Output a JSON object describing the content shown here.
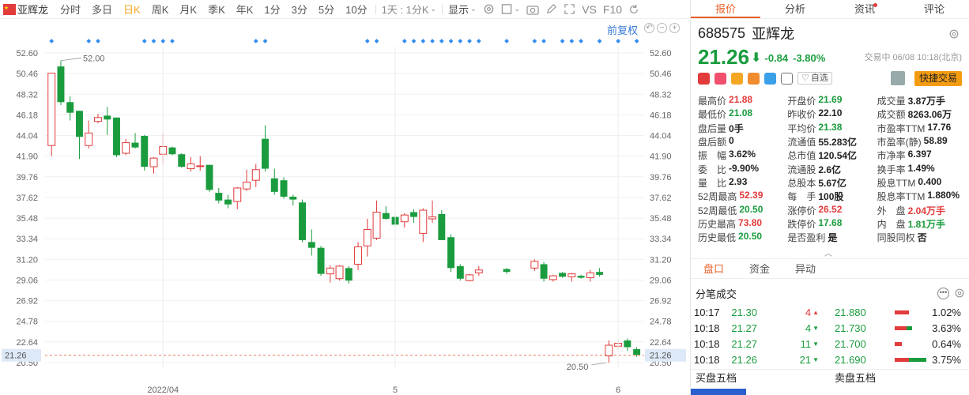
{
  "toolbar": {
    "stock_name": "亚辉龙",
    "periods": [
      "分时",
      "多日",
      "日K",
      "周K",
      "月K",
      "季K",
      "年K",
      "1分",
      "3分",
      "5分",
      "10分"
    ],
    "active_period": "日K",
    "interval_label": "1天 : 1分K",
    "display_label": "显示",
    "compare_label": "VS",
    "f10_label": "F10"
  },
  "chart": {
    "restore_label": "前复权",
    "max_label": "52.00",
    "min_label": "20.50",
    "current_label": "21.26"
  },
  "chart_data": {
    "type": "candlestick",
    "ylim": [
      20.5,
      52.6
    ],
    "y_ticks": [
      "52.60",
      "50.46",
      "48.32",
      "46.18",
      "44.04",
      "41.90",
      "39.76",
      "37.62",
      "35.48",
      "33.34",
      "31.20",
      "29.06",
      "26.92",
      "24.78",
      "22.64",
      "20.50"
    ],
    "x_labels": [
      "2022/04",
      "5",
      "6"
    ],
    "gap_between_candles": [
      46,
      47
    ],
    "current_price": 21.26,
    "candles": [
      {
        "o": 43.0,
        "h": 50.5,
        "l": 41.9,
        "c": 50.5
      },
      {
        "o": 51.2,
        "h": 51.8,
        "l": 47.2,
        "c": 47.5
      },
      {
        "o": 47.5,
        "h": 48.1,
        "l": 45.6,
        "c": 46.4
      },
      {
        "o": 46.6,
        "h": 46.6,
        "l": 41.6,
        "c": 43.9
      },
      {
        "o": 43.0,
        "h": 45.6,
        "l": 42.7,
        "c": 44.3
      },
      {
        "o": 45.5,
        "h": 46.3,
        "l": 45.3,
        "c": 45.9
      },
      {
        "o": 46.1,
        "h": 47.0,
        "l": 44.1,
        "c": 45.7
      },
      {
        "o": 45.9,
        "h": 45.9,
        "l": 41.8,
        "c": 42.0
      },
      {
        "o": 42.2,
        "h": 43.7,
        "l": 42.0,
        "c": 43.3
      },
      {
        "o": 43.3,
        "h": 44.3,
        "l": 42.7,
        "c": 42.8
      },
      {
        "o": 44.0,
        "h": 44.1,
        "l": 40.4,
        "c": 40.8
      },
      {
        "o": 40.8,
        "h": 41.8,
        "l": 40.1,
        "c": 41.7
      },
      {
        "o": 42.1,
        "h": 44.3,
        "l": 41.0,
        "c": 42.9
      },
      {
        "o": 42.8,
        "h": 42.9,
        "l": 42.0,
        "c": 42.1
      },
      {
        "o": 42.1,
        "h": 42.2,
        "l": 40.7,
        "c": 40.8
      },
      {
        "o": 40.6,
        "h": 41.8,
        "l": 40.3,
        "c": 41.1
      },
      {
        "o": 40.9,
        "h": 41.9,
        "l": 40.4,
        "c": 40.9
      },
      {
        "o": 41.0,
        "h": 41.0,
        "l": 38.2,
        "c": 38.4
      },
      {
        "o": 38.1,
        "h": 38.6,
        "l": 37.0,
        "c": 37.3
      },
      {
        "o": 37.4,
        "h": 37.9,
        "l": 36.5,
        "c": 36.9
      },
      {
        "o": 37.2,
        "h": 38.7,
        "l": 36.4,
        "c": 38.6
      },
      {
        "o": 38.5,
        "h": 40.5,
        "l": 38.3,
        "c": 39.2
      },
      {
        "o": 39.4,
        "h": 41.1,
        "l": 38.7,
        "c": 40.5
      },
      {
        "o": 43.7,
        "h": 45.1,
        "l": 40.3,
        "c": 40.6
      },
      {
        "o": 39.6,
        "h": 40.6,
        "l": 37.9,
        "c": 38.2
      },
      {
        "o": 39.4,
        "h": 39.7,
        "l": 37.5,
        "c": 37.7
      },
      {
        "o": 37.7,
        "h": 37.9,
        "l": 36.8,
        "c": 37.4
      },
      {
        "o": 37.1,
        "h": 37.4,
        "l": 33.0,
        "c": 33.2
      },
      {
        "o": 33.0,
        "h": 34.3,
        "l": 31.6,
        "c": 32.4
      },
      {
        "o": 32.4,
        "h": 32.6,
        "l": 29.5,
        "c": 29.7
      },
      {
        "o": 29.7,
        "h": 30.6,
        "l": 28.8,
        "c": 30.3
      },
      {
        "o": 29.2,
        "h": 30.6,
        "l": 29.0,
        "c": 30.5
      },
      {
        "o": 30.3,
        "h": 30.5,
        "l": 28.7,
        "c": 29.0
      },
      {
        "o": 30.7,
        "h": 33.0,
        "l": 30.1,
        "c": 32.5
      },
      {
        "o": 32.6,
        "h": 35.4,
        "l": 31.5,
        "c": 34.3
      },
      {
        "o": 33.4,
        "h": 37.3,
        "l": 33.2,
        "c": 36.1
      },
      {
        "o": 36.0,
        "h": 36.7,
        "l": 35.3,
        "c": 35.4
      },
      {
        "o": 35.6,
        "h": 36.0,
        "l": 34.6,
        "c": 34.8
      },
      {
        "o": 35.1,
        "h": 36.0,
        "l": 34.5,
        "c": 35.8
      },
      {
        "o": 36.1,
        "h": 36.4,
        "l": 35.0,
        "c": 35.6
      },
      {
        "o": 33.9,
        "h": 36.5,
        "l": 33.0,
        "c": 36.3
      },
      {
        "o": 35.4,
        "h": 37.3,
        "l": 35.0,
        "c": 35.6
      },
      {
        "o": 35.9,
        "h": 36.3,
        "l": 33.2,
        "c": 33.2
      },
      {
        "o": 33.5,
        "h": 33.8,
        "l": 29.9,
        "c": 30.3
      },
      {
        "o": 30.5,
        "h": 30.7,
        "l": 29.0,
        "c": 29.2
      },
      {
        "o": 29.0,
        "h": 29.7,
        "l": 28.9,
        "c": 29.6
      },
      {
        "o": 29.8,
        "h": 30.5,
        "l": 29.5,
        "c": 30.1
      },
      {
        "o": 30.2,
        "h": 30.3,
        "l": 29.7,
        "c": 29.9
      },
      {
        "o": 30.3,
        "h": 31.2,
        "l": 30.0,
        "c": 31.0
      },
      {
        "o": 30.7,
        "h": 30.9,
        "l": 28.9,
        "c": 29.2
      },
      {
        "o": 29.1,
        "h": 29.6,
        "l": 28.9,
        "c": 29.5
      },
      {
        "o": 29.8,
        "h": 29.9,
        "l": 29.3,
        "c": 29.4
      },
      {
        "o": 29.4,
        "h": 29.8,
        "l": 28.9,
        "c": 29.7
      },
      {
        "o": 29.5,
        "h": 29.6,
        "l": 29.2,
        "c": 29.3
      },
      {
        "o": 29.3,
        "h": 30.1,
        "l": 28.9,
        "c": 29.8
      },
      {
        "o": 29.9,
        "h": 30.3,
        "l": 29.4,
        "c": 29.6
      },
      {
        "o": 21.2,
        "h": 22.8,
        "l": 20.5,
        "c": 22.3
      },
      {
        "o": 22.2,
        "h": 22.8,
        "l": 21.8,
        "c": 22.5
      },
      {
        "o": 22.8,
        "h": 23.0,
        "l": 21.7,
        "c": 22.1
      },
      {
        "o": 21.9,
        "h": 22.1,
        "l": 21.1,
        "c": 21.3
      }
    ]
  },
  "panel": {
    "tabs": [
      "报价",
      "分析",
      "资讯",
      "评论"
    ],
    "active_tab": "报价",
    "code": "688575",
    "name": "亚辉龙",
    "last_price": "21.26",
    "arrow": "⬇",
    "change": "-0.84",
    "change_pct": "-3.80%",
    "trade_time": "交易中 06/08 10:18(北京)",
    "watch_label": "自选",
    "fast_trade_label": "快捷交易",
    "stats": [
      [
        {
          "label": "最高价",
          "value": "21.88",
          "color": "red"
        },
        {
          "label": "开盘价",
          "value": "21.69",
          "color": "green"
        },
        {
          "label": "成交量",
          "value": "3.87万手",
          "color": ""
        }
      ],
      [
        {
          "label": "最低价",
          "value": "21.08",
          "color": "green"
        },
        {
          "label": "昨收价",
          "value": "22.10",
          "color": ""
        },
        {
          "label": "成交额",
          "value": "8263.06万",
          "color": ""
        }
      ],
      [
        {
          "label": "盘后量",
          "value": "0手",
          "color": ""
        },
        {
          "label": "平均价",
          "value": "21.38",
          "color": "green"
        },
        {
          "label": "市盈率TTM",
          "value": "17.76",
          "color": ""
        }
      ],
      [
        {
          "label": "盘后额",
          "value": "0",
          "color": ""
        },
        {
          "label": "流通值",
          "value": "55.283亿",
          "color": ""
        },
        {
          "label": "市盈率(静)",
          "value": "58.89",
          "color": ""
        }
      ],
      [
        {
          "label": "振　幅",
          "value": "3.62%",
          "color": ""
        },
        {
          "label": "总市值",
          "value": "120.54亿",
          "color": ""
        },
        {
          "label": "市净率",
          "value": "6.397",
          "color": ""
        }
      ],
      [
        {
          "label": "委　比",
          "value": "-9.90%",
          "color": ""
        },
        {
          "label": "流通股",
          "value": "2.6亿",
          "color": ""
        },
        {
          "label": "换手率",
          "value": "1.49%",
          "color": ""
        }
      ],
      [
        {
          "label": "量　比",
          "value": "2.93",
          "color": ""
        },
        {
          "label": "总股本",
          "value": "5.67亿",
          "color": ""
        },
        {
          "label": "股息TTM",
          "value": "0.400",
          "color": ""
        }
      ],
      [
        {
          "label": "52周最高",
          "value": "52.39",
          "color": "red"
        },
        {
          "label": "每　手",
          "value": "100股",
          "color": ""
        },
        {
          "label": "股息率TTM",
          "value": "1.880%",
          "color": ""
        }
      ],
      [
        {
          "label": "52周最低",
          "value": "20.50",
          "color": "green"
        },
        {
          "label": "涨停价",
          "value": "26.52",
          "color": "red"
        },
        {
          "label": "外　盘",
          "value": "2.04万手",
          "color": "red"
        }
      ],
      [
        {
          "label": "历史最高",
          "value": "73.80",
          "color": "red"
        },
        {
          "label": "跌停价",
          "value": "17.68",
          "color": "green"
        },
        {
          "label": "内　盘",
          "value": "1.81万手",
          "color": "green"
        }
      ],
      [
        {
          "label": "历史最低",
          "value": "20.50",
          "color": "green"
        },
        {
          "label": "是否盈利",
          "value": "是",
          "color": ""
        },
        {
          "label": "同股同权",
          "value": "否",
          "color": ""
        }
      ]
    ],
    "subtabs": [
      "盘口",
      "资金",
      "异动"
    ],
    "active_subtab": "盘口",
    "ticks_title": "分笔成交",
    "ticks": [
      {
        "time": "10:17",
        "price": "21.30",
        "vol": "4",
        "dir": "up"
      },
      {
        "time": "10:18",
        "price": "21.27",
        "vol": "4",
        "dir": "down"
      },
      {
        "time": "10:18",
        "price": "21.27",
        "vol": "11",
        "dir": "down"
      },
      {
        "time": "10:18",
        "price": "21.26",
        "vol": "21",
        "dir": "down"
      }
    ],
    "depth": [
      {
        "price": "21.880",
        "pct": "1.02%",
        "red": 0.4,
        "green": 0
      },
      {
        "price": "21.730",
        "pct": "3.63%",
        "red": 0.35,
        "green": 0.15
      },
      {
        "price": "21.700",
        "pct": "0.64%",
        "red": 0.2,
        "green": 0
      },
      {
        "price": "21.690",
        "pct": "3.75%",
        "red": 0.4,
        "green": 0.5
      }
    ],
    "order_book": {
      "buy_label": "买盘五档",
      "sell_label": "卖盘五档"
    }
  },
  "colors": {
    "up": "#e23b3b",
    "down": "#1a9c3e",
    "accent": "#e8612c",
    "link": "#3a7bd5",
    "marker": "#2f8cf0"
  }
}
